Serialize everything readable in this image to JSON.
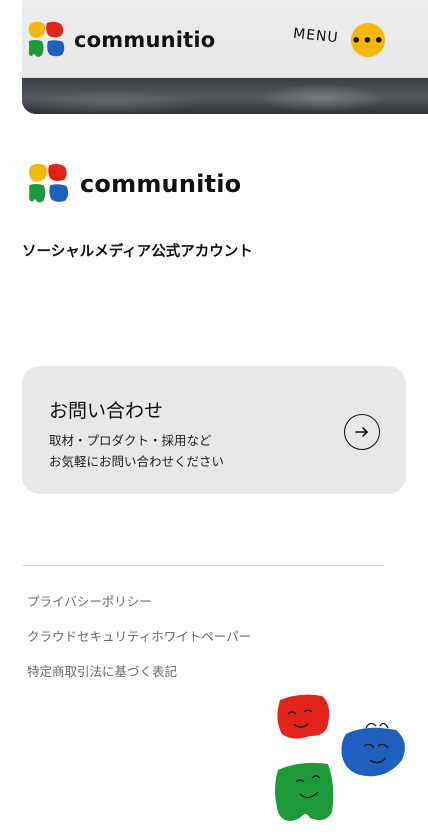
{
  "header": {
    "logo_text": "communitio",
    "menu_label": "MENU",
    "menu_button_glyph": "•••"
  },
  "brand": {
    "logo_text": "communitio",
    "tagline": "ソーシャルメディア公式アカウント",
    "colors": {
      "yellow": "#f6b60a",
      "red": "#e2231a",
      "blue": "#1f5fbf",
      "green": "#1f9a3a"
    }
  },
  "contact": {
    "title": "お問い合わせ",
    "desc_lines": [
      "取材・プロダクト・採用など",
      "お気軽にお問い合わせください"
    ],
    "arrow_icon": "arrow-right-icon"
  },
  "footer": {
    "links": [
      "プライバシーポリシー",
      "クラウドセキュリティホワイトペーパー",
      "特定商取引法に基づく表記"
    ]
  }
}
